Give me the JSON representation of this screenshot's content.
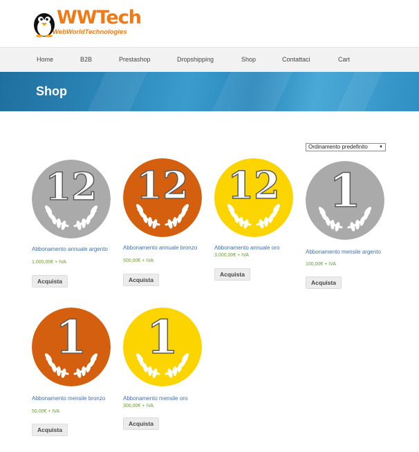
{
  "logo": {
    "title": "WWTech",
    "subtitle": "WebWorldTechnologies",
    "color": "#f07a16"
  },
  "nav": {
    "items": [
      "Home",
      "B2B",
      "Prestashop",
      "Dropshipping",
      "Shop",
      "Contattaci",
      "Cart"
    ]
  },
  "banner": {
    "title": "Shop"
  },
  "sort": {
    "selected": "Ordinamento predefinito"
  },
  "products": [
    {
      "name": "Abbonamento annuale argento",
      "price": "1.000,00€ + IVA",
      "button": "Acquista",
      "medal_number": "12",
      "medal_color": "#aaaaaa"
    },
    {
      "name": "Abbonamento annuale bronzo",
      "price": "500,00€ + IVA",
      "button": "Acquista",
      "medal_number": "12",
      "medal_color": "#d45f0f"
    },
    {
      "name": "Abbonamento annuale oro",
      "price": "3.000,00€ + IVA",
      "button": "Acquista",
      "medal_number": "12",
      "medal_color": "#fcd500"
    },
    {
      "name": "Abbonamento mensile argento",
      "price": "100,00€ + IVA",
      "button": "Acquista",
      "medal_number": "1",
      "medal_color": "#aaaaaa"
    },
    {
      "name": "Abbonamento mensile bronzo",
      "price": "50,00€ + IVA",
      "button": "Acquista",
      "medal_number": "1",
      "medal_color": "#d45f0f"
    },
    {
      "name": "Abbonamento mensile oro",
      "price": "300,00€ + IVA",
      "button": "Acquista",
      "medal_number": "1",
      "medal_color": "#fcd500"
    }
  ]
}
